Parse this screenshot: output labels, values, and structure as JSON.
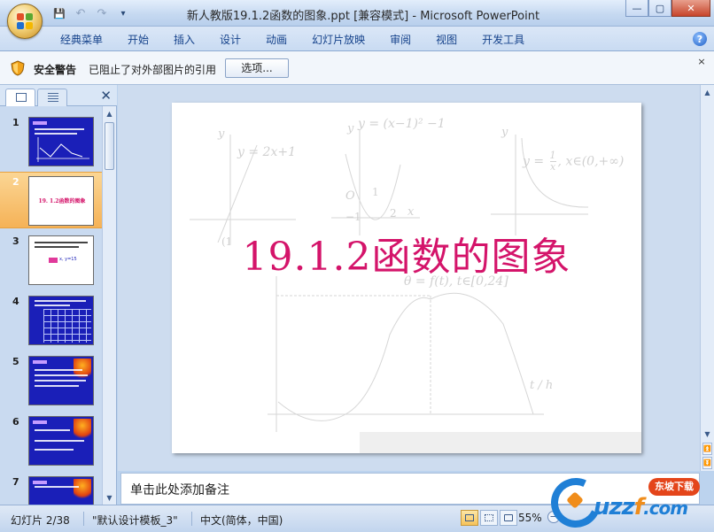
{
  "window": {
    "title": "新人教版19.1.2函数的图象.ppt [兼容模式] - Microsoft PowerPoint",
    "min_glyph": "—",
    "max_glyph": "▢",
    "close_glyph": "✕"
  },
  "qat": {
    "save": "💾",
    "undo": "↶",
    "redo": "↷",
    "more": "▾"
  },
  "ribbon": {
    "tabs": [
      "经典菜单",
      "开始",
      "插入",
      "设计",
      "动画",
      "幻灯片放映",
      "审阅",
      "视图",
      "开发工具"
    ],
    "help": "?"
  },
  "security_bar": {
    "title": "安全警告",
    "message": "已阻止了对外部图片的引用",
    "options_button": "选项...",
    "close": "×"
  },
  "slides_pane": {
    "close": "✕",
    "selected_index": 2,
    "thumbnails": [
      {
        "number": "1",
        "style": "blue-graph"
      },
      {
        "number": "2",
        "style": "title",
        "text": "19. 1.2函数的图象"
      },
      {
        "number": "3",
        "style": "white-text",
        "text": "x, y=15"
      },
      {
        "number": "4",
        "style": "blue-grid"
      },
      {
        "number": "5",
        "style": "blue-palm"
      },
      {
        "number": "6",
        "style": "blue-palm"
      },
      {
        "number": "7",
        "style": "blue-palm"
      }
    ]
  },
  "slide": {
    "title": "19.1.2函数的图象",
    "faded_graphs": {
      "eq1": "y = 2x+1",
      "eq2": "y = (x−1)² −1",
      "eq3a": "y = ",
      "eq3_num": "1",
      "eq3_den": "x",
      "eq3b": ", x∈(0,+∞)",
      "eq4": "θ = f(t), t∈[0,24]",
      "axis_y": "y",
      "axis_x": "x",
      "axis_t": "t / h",
      "origin": "O",
      "lbl_1": "1",
      "lbl_m1": "−1",
      "lbl_2": "2",
      "lbl_paren1": "(1",
      "lbl_m12": "−1/2"
    }
  },
  "notes": {
    "placeholder": "单击此处添加备注"
  },
  "status": {
    "slide": "幻灯片 2/38",
    "theme": "\"默认设计模板_3\"",
    "language": "中文(简体，中国)",
    "zoom": "55%",
    "zoom_minus": "−"
  },
  "watermark": {
    "badge": "东坡下载",
    "brand_a": "uzz",
    "brand_b": "f",
    "brand_c": ".com"
  }
}
